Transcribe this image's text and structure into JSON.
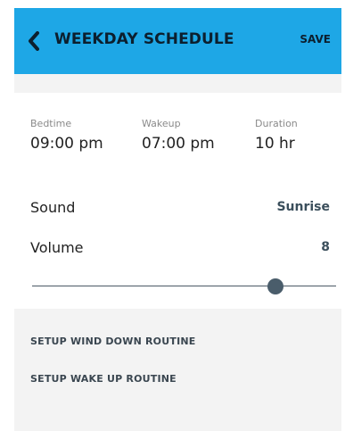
{
  "header": {
    "title": "WEEKDAY SCHEDULE",
    "save_label": "SAVE",
    "back_icon": "chevron-left-icon",
    "bar_color": "#1ea7e6"
  },
  "schedule": {
    "bedtime_label": "Bedtime",
    "bedtime_value": "09:00 pm",
    "wakeup_label": "Wakeup",
    "wakeup_value": "07:00 pm",
    "duration_label": "Duration",
    "duration_value": "10 hr"
  },
  "settings": {
    "sound_label": "Sound",
    "sound_value": "Sunrise",
    "volume_label": "Volume",
    "volume_value": "8",
    "volume_level": 0.8
  },
  "routines": {
    "wind_down": "SETUP WIND DOWN ROUTINE",
    "wake_up": "SETUP WAKE UP ROUTINE"
  }
}
